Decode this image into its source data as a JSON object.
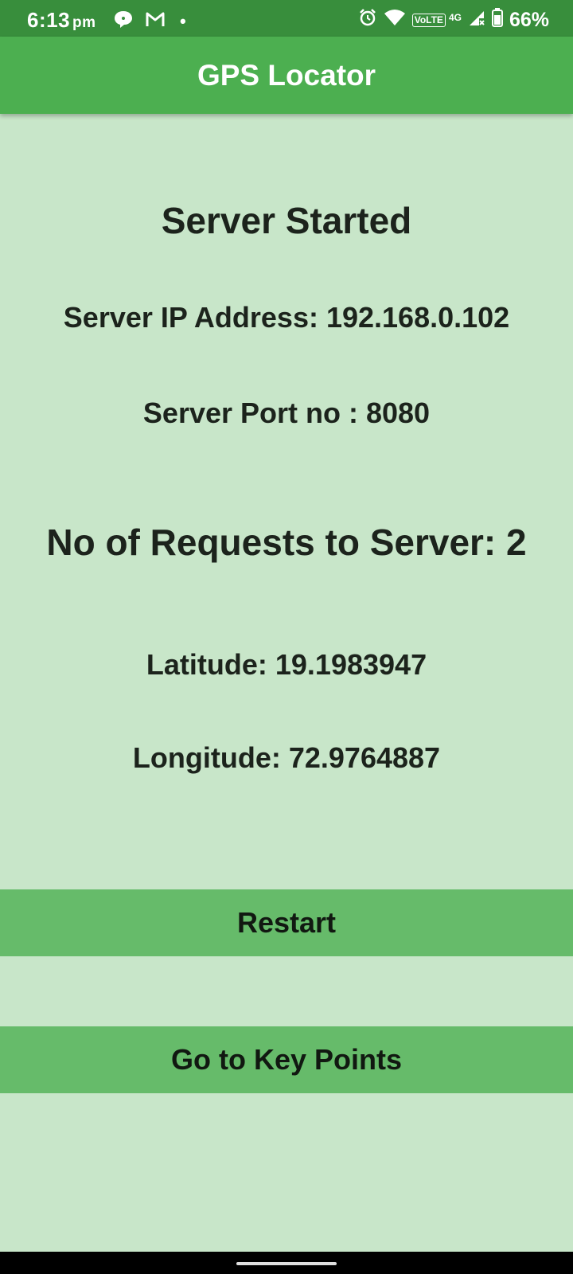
{
  "status_bar": {
    "time": "6:13",
    "ampm": "pm",
    "dot": "•",
    "volte": "VoLTE",
    "network": "4G",
    "battery": "66%",
    "icons": [
      "chat-icon",
      "gmail-icon",
      "alarm-icon",
      "wifi-icon",
      "signal-icon",
      "battery-icon"
    ]
  },
  "app_bar": {
    "title": "GPS Locator"
  },
  "main": {
    "status": "Server Started",
    "ip_line": "Server IP Address: 192.168.0.102",
    "port_line": "Server Port no : 8080",
    "requests_line": "No of Requests to Server: 2",
    "latitude_line": "Latitude: 19.1983947",
    "longitude_line": "Longitude: 72.9764887"
  },
  "buttons": {
    "restart": "Restart",
    "key_points": "Go to Key Points"
  },
  "colors": {
    "status_bar": "#388e3c",
    "app_bar": "#4caf50",
    "background": "#c8e6c9",
    "button": "#66bb6a"
  }
}
